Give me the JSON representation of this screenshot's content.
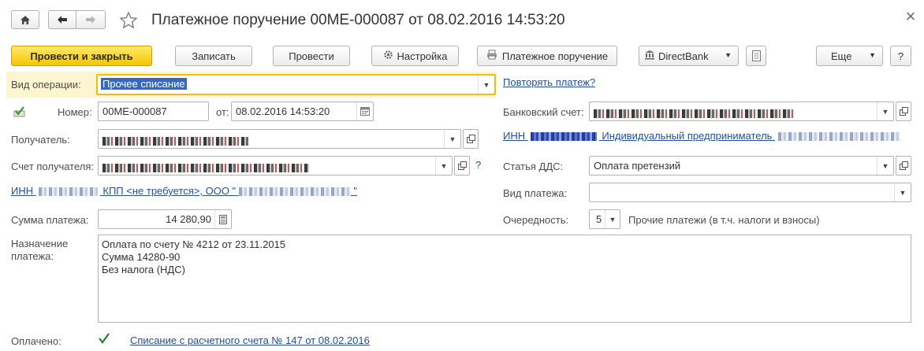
{
  "window": {
    "title": "Платежное поручение 00МЕ-000087 от 08.02.2016 14:53:20"
  },
  "toolbar": {
    "post_close_label": "Провести и закрыть",
    "save_label": "Записать",
    "post_label": "Провести",
    "settings_label": "Настройка",
    "print_label": "Платежное поручение",
    "directbank_label": "DirectBank",
    "more_label": "Еще",
    "help_label": "?"
  },
  "form": {
    "operation_type_label": "Вид операции:",
    "operation_type_value": "Прочее списание",
    "repeat_payment_link": "Повторять платеж?",
    "number_label": "Номер:",
    "number_value": "00МЕ-000087",
    "date_label": "от:",
    "date_value": "08.02.2016 14:53:20",
    "bank_account_label": "Банковский счет:",
    "recipient_label": "Получатель:",
    "inn_ip_prefix": "ИНН",
    "inn_ip_text": "Индивидуальный предприниматель",
    "recipient_account_label": "Счет получателя:",
    "dds_item_label": "Статья ДДС:",
    "dds_item_value": "Оплата претензий",
    "inn_kpp_prefix": "ИНН",
    "inn_kpp_middle": "КПП <не требуется>, ООО \"",
    "inn_kpp_suffix": "\"",
    "payment_type_label": "Вид платежа:",
    "payment_type_value": "",
    "amount_label": "Сумма платежа:",
    "amount_value": "14 280,90",
    "priority_label": "Очередность:",
    "priority_value": "5",
    "priority_text": "Прочие платежи (в т.ч. налоги и взносы)",
    "purpose_label_1": "Назначение",
    "purpose_label_2": "платежа:",
    "purpose_lines": [
      "Оплата по счету № 4212 от 23.11.2015",
      "Сумма 14280-90",
      "Без налога (НДС)"
    ],
    "paid_label": "Оплачено:",
    "paid_link": "Списание с расчетного счета № 147 от 08.02.2016"
  },
  "colors": {
    "accent_yellow": "#f5c500",
    "link_blue": "#1f4f9e",
    "active_border": "#f0c000"
  }
}
